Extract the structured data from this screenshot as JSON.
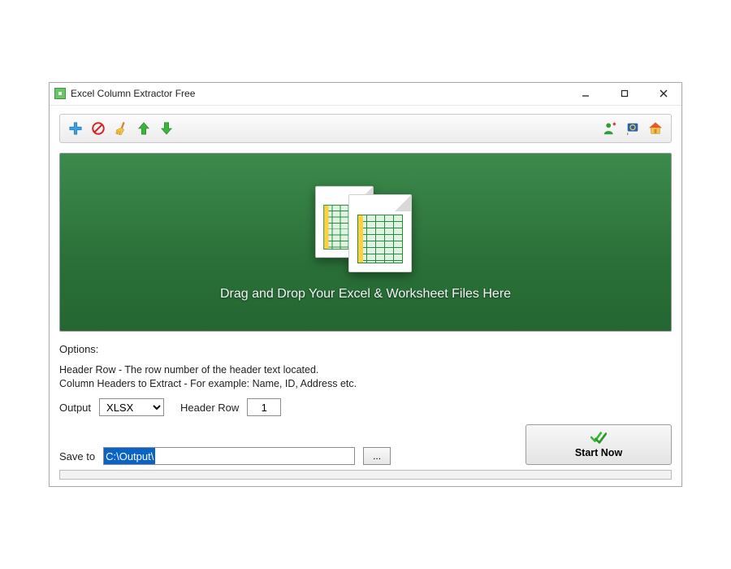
{
  "window": {
    "title": "Excel Column Extractor Free"
  },
  "toolbar": {
    "icons": {
      "add": "add-icon",
      "remove": "remove-icon",
      "clear": "clear-icon",
      "move_up": "arrow-up-icon",
      "move_down": "arrow-down-icon",
      "about": "user-icon",
      "language": "flag-icon",
      "home": "home-icon"
    }
  },
  "dropzone": {
    "text": "Drag and Drop Your Excel & Worksheet Files Here"
  },
  "options": {
    "heading": "Options:",
    "help_line1": "Header Row - The row number of the header text located.",
    "help_line2": "Column Headers to Extract - For example: Name, ID, Address etc.",
    "output_label": "Output",
    "output_value": "XLSX",
    "header_row_label": "Header Row",
    "header_row_value": "1",
    "saveto_label": "Save to",
    "saveto_value": "C:\\Output\\",
    "browse_label": "..."
  },
  "start": {
    "label": "Start Now"
  }
}
